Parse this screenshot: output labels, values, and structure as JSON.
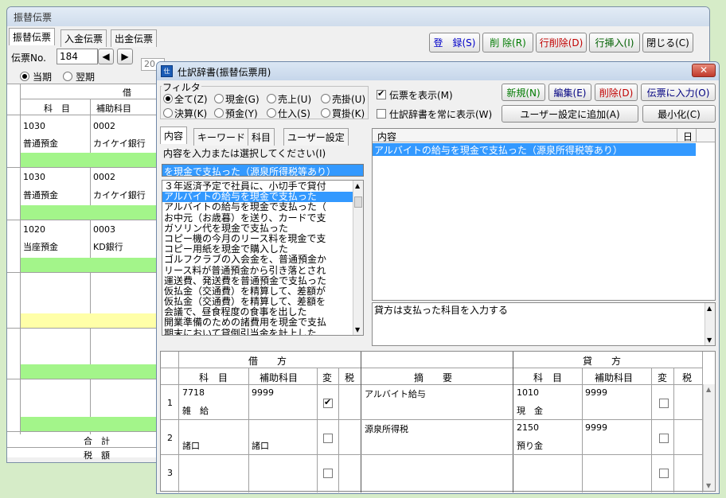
{
  "bg": {
    "title": "振替伝票",
    "tabs": [
      "振替伝票",
      "入金伝票",
      "出金伝票"
    ],
    "denpyo_label": "伝票No.",
    "denpyo_no": "184",
    "date_hint": "20",
    "period": [
      "当期",
      "翌期"
    ],
    "buttons": {
      "register": "登　録(S)",
      "delete": "削 除(R)",
      "delete_row": "行削除(D)",
      "insert_row": "行挿入(I)",
      "close": "閉じる(C)"
    },
    "header_debit": "借",
    "col_kamoku": "科　目",
    "col_hojo": "補助科目",
    "rows": [
      {
        "code": "1030",
        "name": "普通預金",
        "hcode": "0002",
        "hname": "カイケイ銀行"
      },
      {
        "code": "1030",
        "name": "普通預金",
        "hcode": "0002",
        "hname": "カイケイ銀行"
      },
      {
        "code": "1020",
        "name": "当座預金",
        "hcode": "0003",
        "hname": "KD銀行"
      }
    ],
    "total": "合　計",
    "tax": "税　額"
  },
  "dlg": {
    "title": "仕訳辞書(振替伝票用)",
    "filter_label": "フィルタ",
    "filters_row1": [
      "全て(Z)",
      "現金(G)",
      "売上(U)",
      "売掛(U)"
    ],
    "filters_row2": [
      "決算(K)",
      "預金(Y)",
      "仕入(S)",
      "買掛(K)"
    ],
    "show_denpyo": "伝票を表示(M)",
    "always_show": "仕訳辞書を常に表示(W)",
    "buttons": {
      "new": "新規(N)",
      "edit": "編集(E)",
      "delete": "削除(D)",
      "to_denpyo": "伝票に入力(O)",
      "add_user": "ユーザー設定に追加(A)",
      "minimize": "最小化(C)"
    },
    "tabs": [
      "内容",
      "キーワード",
      "科目",
      "ユーザー設定"
    ],
    "prompt": "内容を入力または選択してください(I)",
    "search_value": "を現金で支払った（源泉所得税等あり）",
    "list_items": [
      "３年返済予定で社員に、小切手で貸付",
      "アルバイトの給与を現金で支払った",
      "アルバイトの給与を現金で支払った（",
      "お中元（お歳暮）を送り、カードで支",
      "ガソリン代を現金で支払った",
      "コピー機の今月のリース料を現金で支",
      "コピー用紙を現金で購入した",
      "ゴルフクラブの入会金を、普通預金か",
      "リース料が普通預金から引き落とされ",
      "運送費、発送費を普通預金で支払った",
      "仮払金（交通費）を精算して、差額が",
      "仮払金（交通費）を精算して、差額を",
      "会議で、昼食程度の食事を出した",
      "開業準備のための諸費用を現金で支払",
      "期末において貸倒引当金を計上した"
    ],
    "list_selected": 1,
    "right_header": "内容",
    "right_header_day": "日",
    "right_selected": "アルバイトの給与を現金で支払った（源泉所得税等あり）",
    "memo": "貸方は支払った科目を入力する",
    "grid": {
      "debit": "借　　方",
      "credit": "貸　　方",
      "kamoku": "科　目",
      "hojo": "補助科目",
      "hen": "変",
      "zei": "税",
      "tekiyo": "摘　　要",
      "rows": [
        {
          "no": "1",
          "dcode": "7718",
          "dname": "雑　給",
          "dhcode": "9999",
          "dhname": "",
          "dchk": true,
          "memo": "アルバイト給与",
          "ccode": "1010",
          "cname": "現　金",
          "chcode": "9999",
          "chname": ""
        },
        {
          "no": "2",
          "dcode": "",
          "dname": "諸口",
          "dhcode": "",
          "dhname": "諸口",
          "dchk": false,
          "memo": "源泉所得税",
          "ccode": "2150",
          "cname": "預り金",
          "chcode": "9999",
          "chname": ""
        },
        {
          "no": "3",
          "dcode": "",
          "dname": "",
          "dhcode": "",
          "dhname": "",
          "dchk": false,
          "memo": "",
          "ccode": "",
          "cname": "",
          "chcode": "",
          "chname": ""
        }
      ]
    }
  }
}
